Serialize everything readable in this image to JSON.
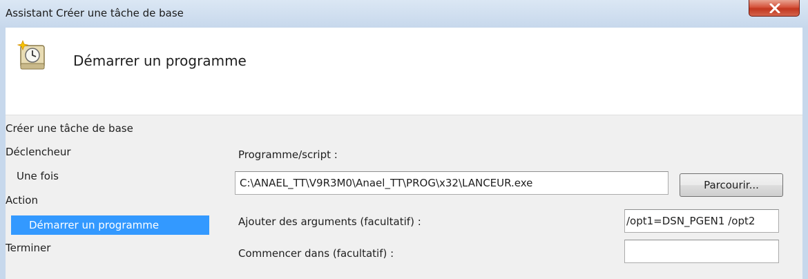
{
  "window": {
    "title": "Assistant Créer une tâche de base",
    "close_symbol": "X"
  },
  "header": {
    "title": "Démarrer un programme",
    "icon": "scheduled-task-clock-icon"
  },
  "steps": [
    {
      "label": "Créer une tâche de base",
      "selected": false
    },
    {
      "label": "Déclencheur",
      "selected": false
    },
    {
      "label": "Une fois",
      "selected": false
    },
    {
      "label": "Action",
      "selected": false
    },
    {
      "label": "Démarrer un programme",
      "selected": true
    },
    {
      "label": "Terminer",
      "selected": false
    }
  ],
  "form": {
    "program_label": "Programme/script :",
    "program_value": "C:\\ANAEL_TT\\V9R3M0\\Anael_TT\\PROG\\x32\\LANCEUR.exe",
    "browse_label": "Parcourir...",
    "args_label": "Ajouter des arguments (facultatif) :",
    "args_value": "/opt1=DSN_PGEN1 /opt2",
    "startin_label": "Commencer dans (facultatif) :",
    "startin_value": ""
  },
  "colors": {
    "selection": "#3399ff",
    "close_button": "#c2371f",
    "titlebar": "#c7d8ec"
  }
}
